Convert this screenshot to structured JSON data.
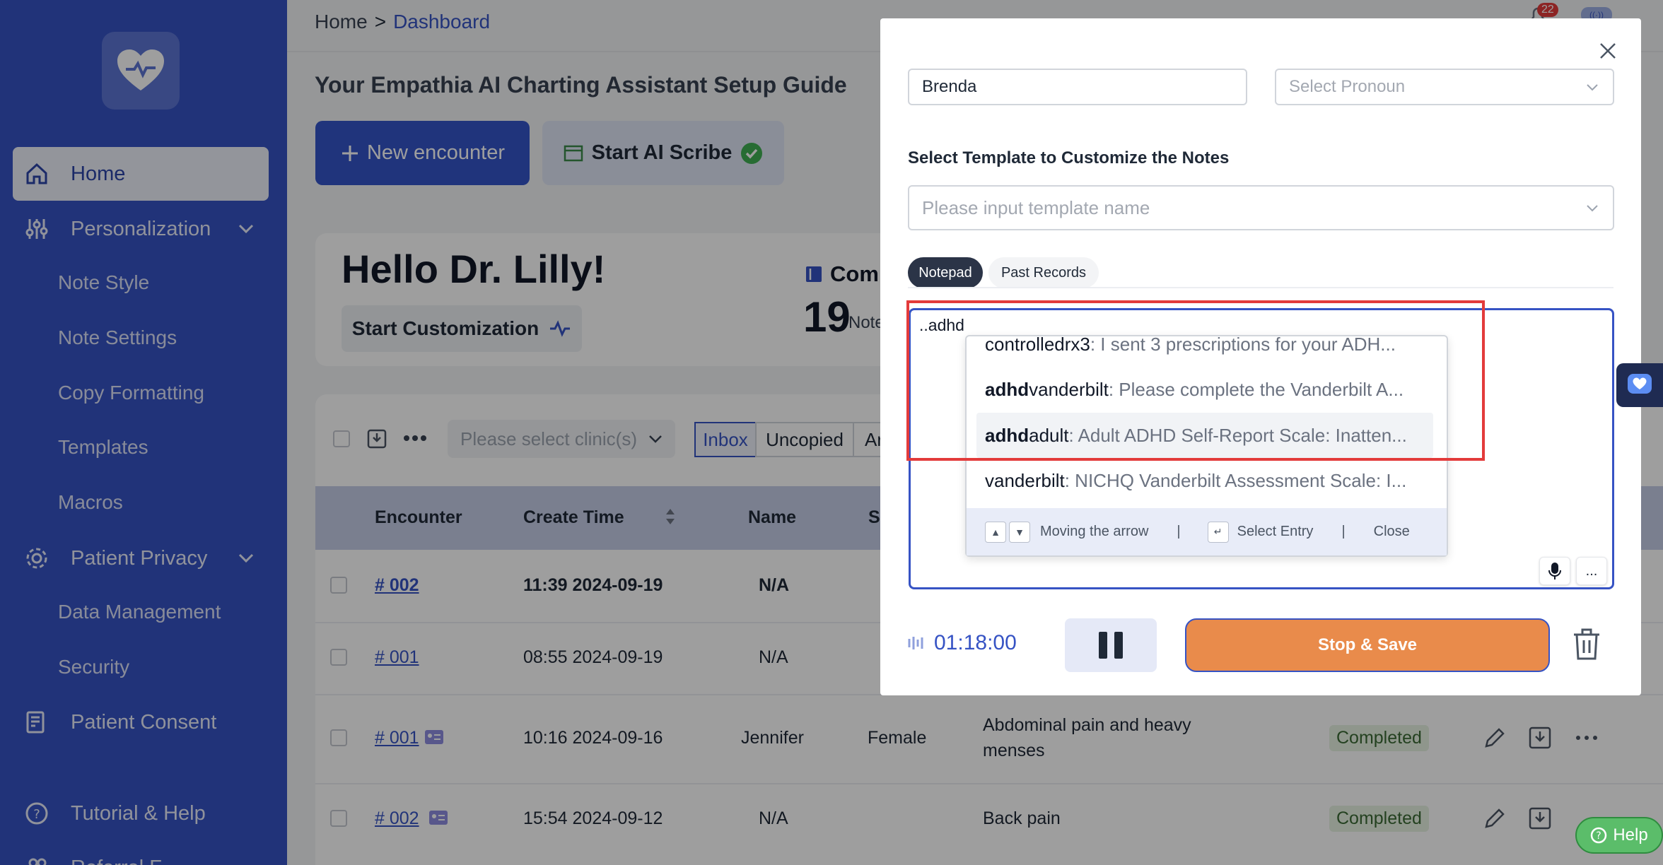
{
  "sidebar": {
    "items": [
      {
        "label": "Home"
      },
      {
        "label": "Personalization"
      },
      {
        "label": "Note Style"
      },
      {
        "label": "Note Settings"
      },
      {
        "label": "Copy Formatting"
      },
      {
        "label": "Templates"
      },
      {
        "label": "Macros"
      },
      {
        "label": "Patient Privacy"
      },
      {
        "label": "Data Management"
      },
      {
        "label": "Security"
      },
      {
        "label": "Patient Consent"
      },
      {
        "label": "Tutorial & Help"
      },
      {
        "label": "Referral F..."
      }
    ]
  },
  "breadcrumb": {
    "home": "Home",
    "sep": ">",
    "current": "Dashboard"
  },
  "header": {
    "notifications": "22"
  },
  "main": {
    "setup_title": "Your Empathia AI Charting Assistant Setup Guide",
    "new_encounter": "New encounter",
    "start_scribe": "Start AI Scribe",
    "hello": "Hello Dr. Lilly!",
    "start_customization": "Start Customization",
    "stat_label": "Com",
    "stat_num": "19",
    "stat_sub": "Note"
  },
  "table": {
    "clinic_placeholder": "Please select clinic(s)",
    "filters": [
      "Inbox",
      "Uncopied",
      "Ar"
    ],
    "columns": [
      "Encounter",
      "Create Time",
      "Name",
      "S"
    ],
    "rows": [
      {
        "id": "# 002",
        "time": "11:39 2024-09-19",
        "name": "N/A",
        "sex": "",
        "complaint": "",
        "status": ""
      },
      {
        "id": "# 001",
        "time": "08:55 2024-09-19",
        "name": "N/A",
        "sex": "",
        "complaint": "",
        "status": ""
      },
      {
        "id": "# 001",
        "time": "10:16 2024-09-16",
        "name": "Jennifer",
        "sex": "Female",
        "complaint": "Abdominal pain and heavy",
        "complaint2": "menses",
        "status": "Completed"
      },
      {
        "id": "# 002",
        "time": "15:54 2024-09-12",
        "name": "N/A",
        "sex": "",
        "complaint": "Back pain",
        "status": "Completed"
      }
    ]
  },
  "modal": {
    "name_value": "Brenda",
    "pronoun_placeholder": "Select Pronoun",
    "template_label": "Select Template to Customize the Notes",
    "template_placeholder": "Please input template name",
    "tabs": [
      "Notepad",
      "Past Records"
    ],
    "notepad_text": "..adhd",
    "suggestions": [
      {
        "match": "",
        "rest": "controlledrx3",
        "desc": " : I sent 3 prescriptions for your ADH..."
      },
      {
        "match": "adhd",
        "rest": "vanderbilt",
        "desc": " : Please complete the Vanderbilt A..."
      },
      {
        "match": "adhd",
        "rest": "adult",
        "desc": " : Adult ADHD Self-Report Scale: Inatten..."
      },
      {
        "match": "",
        "rest": "vanderbilt",
        "desc": " : NICHQ Vanderbilt Assessment Scale: I..."
      }
    ],
    "footer": {
      "move": "Moving the arrow",
      "sep": "|",
      "select": "Select Entry",
      "close": "Close"
    },
    "more": "...",
    "timer": "01:18:00",
    "stop_save": "Stop & Save"
  },
  "help": "Help",
  "colors": {
    "sidebar": "#3653c4",
    "accent": "#3653c4",
    "stop": "#e98b4b",
    "highlight": "#e33b3b"
  }
}
